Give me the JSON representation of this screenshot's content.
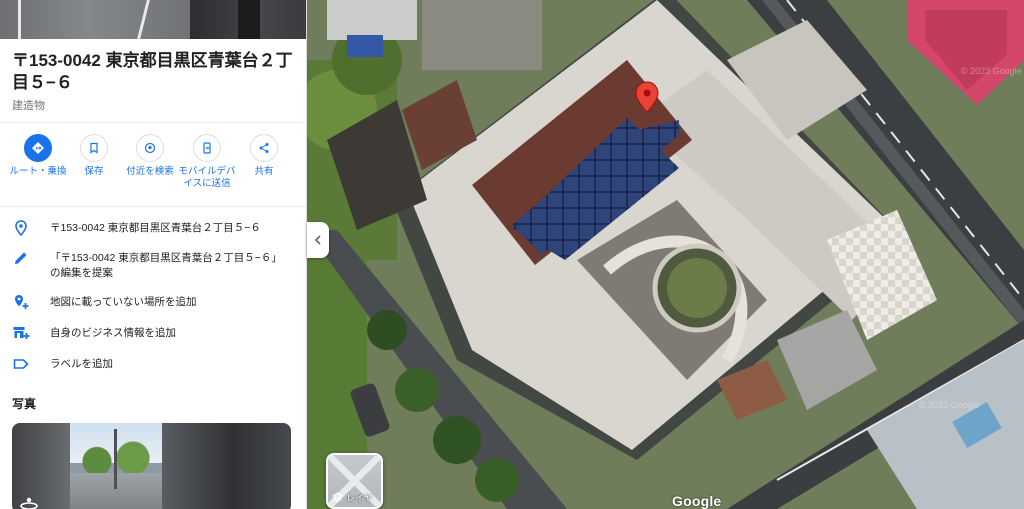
{
  "place": {
    "title": "〒153-0042 東京都目黒区青葉台２丁目５−６",
    "category": "建造物"
  },
  "actions": [
    {
      "label": "ルート・乗換",
      "icon": "directions-icon",
      "primary": true
    },
    {
      "label": "保存",
      "icon": "bookmark-icon",
      "primary": false
    },
    {
      "label": "付近を検索",
      "icon": "nearby-search-icon",
      "primary": false
    },
    {
      "label": "モバイルデバイスに送信",
      "icon": "send-to-phone-icon",
      "primary": false
    },
    {
      "label": "共有",
      "icon": "share-icon",
      "primary": false
    }
  ],
  "info_rows": [
    {
      "text": "〒153-0042 東京都目黒区青葉台２丁目５−６",
      "icon": "location-pin-icon"
    },
    {
      "text": "「〒153-0042 東京都目黒区青葉台２丁目５−６」",
      "text2": "の編集を提案",
      "icon": "edit-pencil-icon"
    },
    {
      "text": "地図に載っていない場所を追加",
      "icon": "add-place-icon"
    },
    {
      "text": "自身のビジネス情報を追加",
      "icon": "storefront-add-icon"
    },
    {
      "text": "ラベルを追加",
      "icon": "label-icon"
    }
  ],
  "photos": {
    "heading": "写真"
  },
  "map": {
    "layers_label": "レイヤ",
    "logo": "Google",
    "watermark": "© 2023 Google",
    "pin_color": "#ea4335"
  },
  "colors": {
    "accent": "#1a73e8",
    "text": "#202124",
    "muted": "#70757a"
  }
}
